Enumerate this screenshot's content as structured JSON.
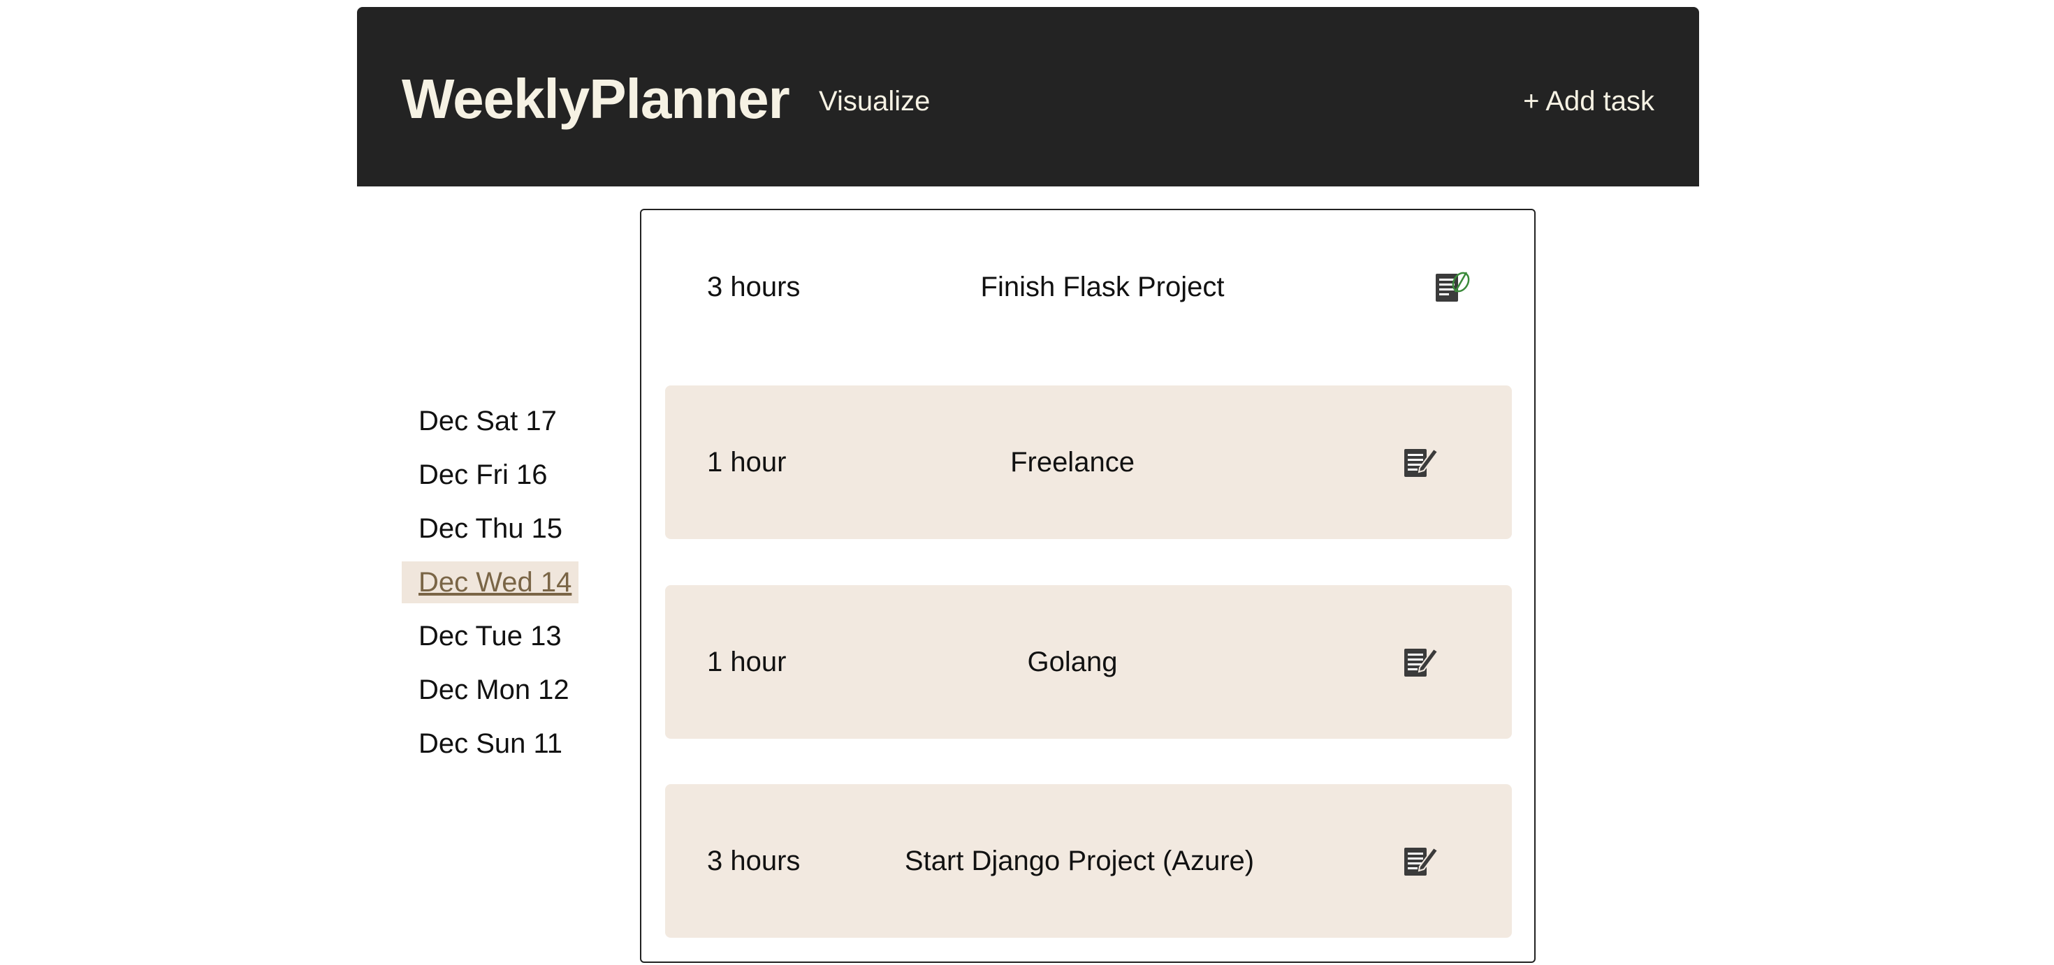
{
  "header": {
    "brand": "WeeklyPlanner",
    "visualize_label": "Visualize",
    "add_task_label": "+ Add task"
  },
  "days": [
    {
      "label": "Dec Sat 17",
      "active": false
    },
    {
      "label": "Dec Fri 16",
      "active": false
    },
    {
      "label": "Dec Thu 15",
      "active": false
    },
    {
      "label": "Dec Wed 14",
      "active": true
    },
    {
      "label": "Dec Tue 13",
      "active": false
    },
    {
      "label": "Dec Mon 12",
      "active": false
    },
    {
      "label": "Dec Sun 11",
      "active": false
    }
  ],
  "tasks": [
    {
      "hours": "3 hours",
      "title": "Finish Flask Project",
      "icon": "edit-done-icon",
      "style": "plain"
    },
    {
      "hours": "1 hour",
      "title": "Freelance",
      "icon": "edit-icon",
      "style": "filled"
    },
    {
      "hours": "1 hour",
      "title": "Golang",
      "icon": "edit-icon",
      "style": "filled"
    },
    {
      "hours": "3 hours",
      "title": "Start Django Project (Azure)",
      "icon": "edit-icon",
      "style": "filled"
    }
  ],
  "colors": {
    "header_bg": "#232323",
    "header_text": "#f6f2e4",
    "task_bg": "#f2e9e0",
    "active_day_bg": "#f0e6dc",
    "active_day_text": "#7a6546",
    "done_accent": "#3a8a3a"
  }
}
